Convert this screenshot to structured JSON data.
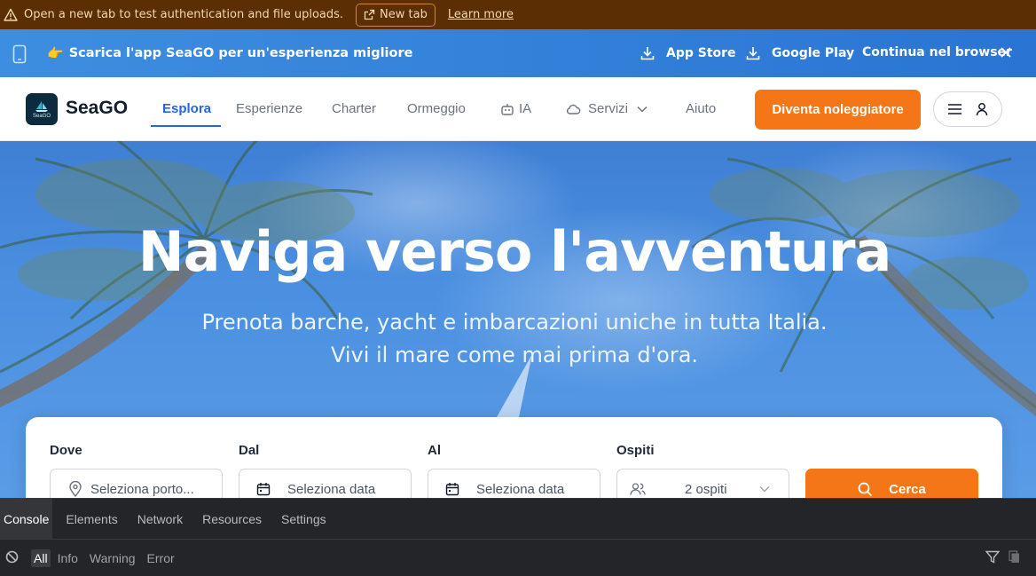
{
  "warning_bar": {
    "message": "Open a new tab to test authentication and file uploads.",
    "new_tab_label": "New tab",
    "learn_more_label": "Learn more"
  },
  "app_banner": {
    "hand_emoji": "👉",
    "promo_text": "Scarica l'app SeaGO per un'esperienza migliore",
    "app_store_label": "App Store",
    "google_play_label": "Google Play",
    "continue_label": "Continua nel browser"
  },
  "nav": {
    "logo_small": "SeaGO",
    "brand": "SeaGO",
    "items": [
      {
        "label": "Esplora",
        "active": true
      },
      {
        "label": "Esperienze"
      },
      {
        "label": "Charter"
      },
      {
        "label": "Ormeggio"
      },
      {
        "label": "IA",
        "icon": "robot-icon"
      },
      {
        "label": "Servizi",
        "icon": "cloud-icon",
        "dropdown": true
      },
      {
        "label": "Aiuto"
      }
    ],
    "cta_label": "Diventa noleggiatore"
  },
  "hero": {
    "title": "Naviga verso l'avventura",
    "subtitle_line1": "Prenota barche, yacht e imbarcazioni uniche in tutta Italia.",
    "subtitle_line2": "Vivi il mare come mai prima d'ora."
  },
  "search": {
    "where_label": "Dove",
    "where_placeholder": "Seleziona porto...",
    "from_label": "Dal",
    "from_placeholder": "Seleziona data",
    "to_label": "Al",
    "to_placeholder": "Seleziona data",
    "guests_label": "Ospiti",
    "guests_value": "2 ospiti",
    "search_label": "Cerca"
  },
  "devtools": {
    "tabs": [
      "Console",
      "Elements",
      "Network",
      "Resources",
      "Settings"
    ],
    "levels": [
      "All",
      "Info",
      "Warning",
      "Error"
    ]
  },
  "colors": {
    "accent_orange": "#f47616",
    "nav_active_blue": "#2563eb",
    "banner_blue": "#2a74d3",
    "warning_brown": "#5b2e04"
  }
}
